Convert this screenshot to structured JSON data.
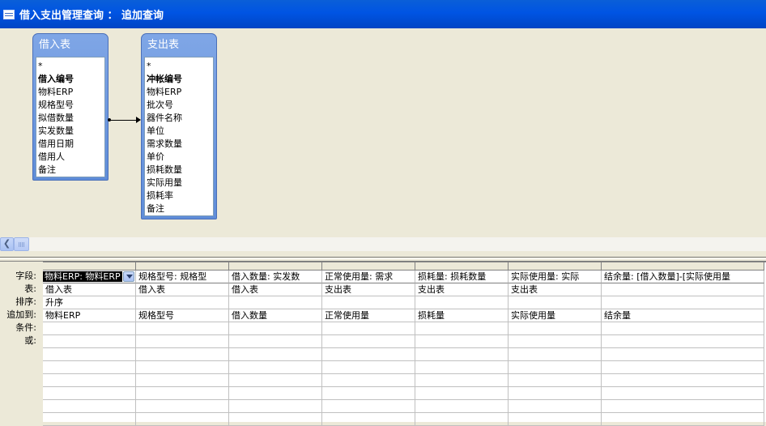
{
  "window": {
    "title": "借入支出管理查询 ： 追加查询"
  },
  "tables": [
    {
      "name": "借入表",
      "fields": [
        "*",
        "借入编号",
        "物料ERP",
        "规格型号",
        "拟借数量",
        "实发数量",
        "借用日期",
        "借用人",
        "备注"
      ],
      "key_field": "借入编号"
    },
    {
      "name": "支出表",
      "fields": [
        "*",
        "冲帐编号",
        "物料ERP",
        "批次号",
        "器件名称",
        "单位",
        "需求数量",
        "单价",
        "损耗数量",
        "实际用量",
        "损耗率",
        "备注"
      ],
      "key_field": "冲帐编号"
    }
  ],
  "grid": {
    "row_labels": [
      "字段:",
      "表:",
      "排序:",
      "追加到:",
      "条件:",
      "或:"
    ],
    "columns": [
      {
        "field": "物料ERP: 物料ERP",
        "table": "借入表",
        "sort": "升序",
        "append_to": "物料ERP"
      },
      {
        "field": "规格型号: 规格型",
        "table": "借入表",
        "sort": "",
        "append_to": "规格型号"
      },
      {
        "field": "借入数量: 实发数",
        "table": "借入表",
        "sort": "",
        "append_to": "借入数量"
      },
      {
        "field": "正常使用量: 需求",
        "table": "支出表",
        "sort": "",
        "append_to": "正常使用量"
      },
      {
        "field": "损耗量: 损耗数量",
        "table": "支出表",
        "sort": "",
        "append_to": "损耗量"
      },
      {
        "field": "实际使用量: 实际",
        "table": "支出表",
        "sort": "",
        "append_to": "实际使用量"
      },
      {
        "field": "结余量: [借入数量]-[实际使用量",
        "table": "",
        "sort": "",
        "append_to": "结余量"
      }
    ]
  }
}
